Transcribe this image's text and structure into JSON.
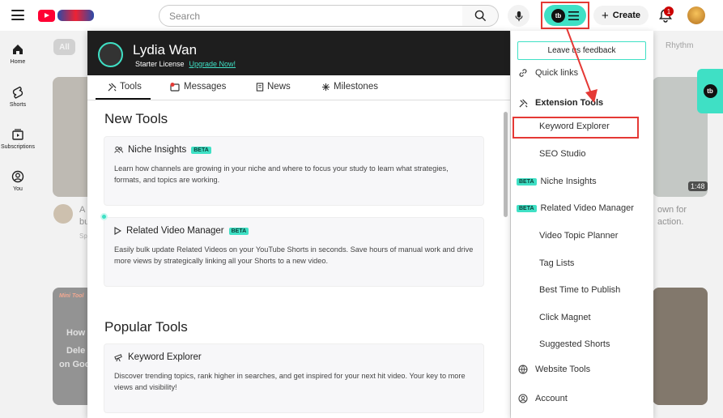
{
  "youtube": {
    "search_placeholder": "Search",
    "create_label": "Create",
    "notification_count": "1",
    "chip_all": "All",
    "chip_rhythm": "Rhythm",
    "rail": [
      {
        "label": "Home",
        "icon": "home-icon"
      },
      {
        "label": "Shorts",
        "icon": "shorts-icon"
      },
      {
        "label": "Subscriptions",
        "icon": "subscriptions-icon"
      },
      {
        "label": "You",
        "icon": "you-icon"
      }
    ],
    "background_texts": {
      "duration": "1:48",
      "right_line1": "own for",
      "right_line2": "action.",
      "left_a": "A",
      "left_b": "bu",
      "left_sp": "Sp",
      "thumb_brand": "Mini Tool",
      "thumb_line1": "How",
      "thumb_line2": "Dele",
      "thumb_line3": "on Goo"
    }
  },
  "panel": {
    "user_name": "Lydia Wan",
    "license": "Starter License",
    "upgrade": "Upgrade Now!",
    "tabs": [
      "Tools",
      "Messages",
      "News",
      "Milestones"
    ],
    "new_tools_heading": "New Tools",
    "popular_tools_heading": "Popular Tools",
    "beta_label": "BETA",
    "cards": [
      {
        "title": "Niche Insights",
        "desc": "Learn how channels are growing in your niche and where to focus your study to learn what strategies, formats, and topics are working."
      },
      {
        "title": "Related Video Manager",
        "desc": "Easily bulk update Related Videos on your YouTube Shorts in seconds. Save hours of manual work and drive more views by strategically linking all your Shorts to a new video."
      },
      {
        "title": "Keyword Explorer",
        "desc": "Discover trending topics, rank higher in searches, and get inspired for your next hit video. Your key to more views and visibility!"
      }
    ]
  },
  "menu": {
    "feedback": "Leave us feedback",
    "quick_links": "Quick links",
    "extension_tools": "Extension Tools",
    "items": [
      {
        "label": "Keyword Explorer"
      },
      {
        "label": "SEO Studio"
      },
      {
        "label": "Niche Insights",
        "beta": true
      },
      {
        "label": "Related Video Manager",
        "beta": true
      },
      {
        "label": "Video Topic Planner"
      },
      {
        "label": "Tag Lists"
      },
      {
        "label": "Best Time to Publish"
      },
      {
        "label": "Click Magnet"
      },
      {
        "label": "Suggested Shorts"
      }
    ],
    "website_tools": "Website Tools",
    "account": "Account",
    "beta_label": "BETA"
  },
  "colors": {
    "accent": "#3fe0c5",
    "highlight": "#e53935",
    "header_bg": "#1e1e1e",
    "youtube_red": "#ff0033"
  }
}
